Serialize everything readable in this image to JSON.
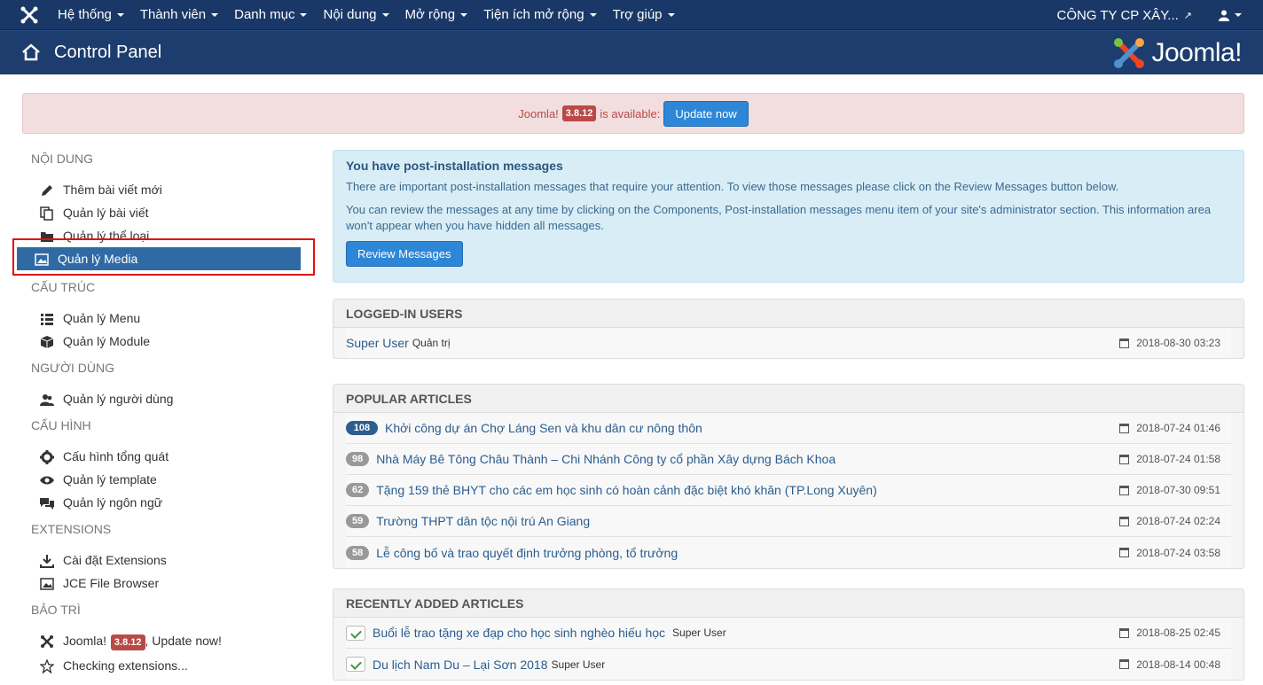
{
  "topbar": {
    "menu": [
      "Hệ thống",
      "Thành viên",
      "Danh mục",
      "Nội dung",
      "Mở rộng",
      "Tiện ích mở rộng",
      "Trợ giúp"
    ],
    "site_name": "CÔNG TY CP XÂY..."
  },
  "header": {
    "title": "Control Panel",
    "brand": "Joomla!"
  },
  "update_alert": {
    "prefix": "Joomla!",
    "version": "3.8.12",
    "suffix": "is available:",
    "button": "Update now"
  },
  "sidebar": {
    "sections": [
      {
        "title": "NỘI DUNG",
        "items": [
          {
            "label": "Thêm bài viết mới",
            "icon": "pencil-icon"
          },
          {
            "label": "Quản lý bài viết",
            "icon": "copy-icon"
          },
          {
            "label": "Quản lý thể loại",
            "icon": "folder-icon"
          },
          {
            "label": "Quản lý Media",
            "icon": "image-icon",
            "active": true
          }
        ]
      },
      {
        "title": "CẤU TRÚC",
        "items": [
          {
            "label": "Quản lý Menu",
            "icon": "list-icon"
          },
          {
            "label": "Quản lý Module",
            "icon": "cube-icon"
          }
        ]
      },
      {
        "title": "NGƯỜI DÙNG",
        "items": [
          {
            "label": "Quản lý người dùng",
            "icon": "users-icon"
          }
        ]
      },
      {
        "title": "CẤU HÌNH",
        "items": [
          {
            "label": "Cấu hình tổng quát",
            "icon": "gear-icon"
          },
          {
            "label": "Quản lý template",
            "icon": "eye-icon"
          },
          {
            "label": "Quản lý ngôn ngữ",
            "icon": "comments-icon"
          }
        ]
      },
      {
        "title": "EXTENSIONS",
        "items": [
          {
            "label": "Cài đặt Extensions",
            "icon": "download-icon"
          },
          {
            "label": "JCE File Browser",
            "icon": "image-icon"
          }
        ]
      },
      {
        "title": "BẢO TRÌ",
        "items": [
          {
            "label": "Joomla!",
            "icon": "joomla-icon",
            "badge": "3.8.12",
            "suffix": ", Update now!"
          },
          {
            "label": "Checking extensions...",
            "icon": "star-icon"
          }
        ]
      }
    ]
  },
  "postinstall": {
    "title": "You have post-installation messages",
    "text1": "There are important post-installation messages that require your attention. To view those messages please click on the Review Messages button below.",
    "text2": "You can review the messages at any time by clicking on the Components, Post-installation messages menu item of your site's administrator section. This information area won't appear when you have hidden all messages.",
    "button": "Review Messages"
  },
  "logged_in": {
    "title": "LOGGED-IN USERS",
    "rows": [
      {
        "name": "Super User",
        "role": "Quản trị",
        "date": "2018-08-30 03:23"
      }
    ]
  },
  "popular": {
    "title": "POPULAR ARTICLES",
    "rows": [
      {
        "hits": "108",
        "title": "Khởi công dự án Chợ Láng Sen và khu dân cư nông thôn",
        "date": "2018-07-24 01:46"
      },
      {
        "hits": "98",
        "title": "Nhà Máy Bê Tông Châu Thành – Chi Nhánh Công ty cổ phần Xây dựng Bách Khoa",
        "date": "2018-07-24 01:58"
      },
      {
        "hits": "62",
        "title": "Tặng 159 thẻ BHYT cho các em học sinh có hoàn cảnh đặc biệt khó khăn (TP.Long Xuyên)",
        "date": "2018-07-30 09:51"
      },
      {
        "hits": "59",
        "title": "Trường THPT dân tộc nội trú An Giang",
        "date": "2018-07-24 02:24"
      },
      {
        "hits": "58",
        "title": "Lễ công bố và trao quyết định trưởng phòng, tổ trưởng",
        "date": "2018-07-24 03:58"
      }
    ]
  },
  "recent": {
    "title": "RECENTLY ADDED ARTICLES",
    "rows": [
      {
        "title": "Buổi lễ trao tặng xe đạp cho học sinh nghèo hiếu học",
        "author": "Super User",
        "date": "2018-08-25 02:45"
      },
      {
        "title": "Du lịch Nam Du – Lại Sơn 2018",
        "author": "Super User",
        "date": "2018-08-14 00:48"
      }
    ]
  }
}
